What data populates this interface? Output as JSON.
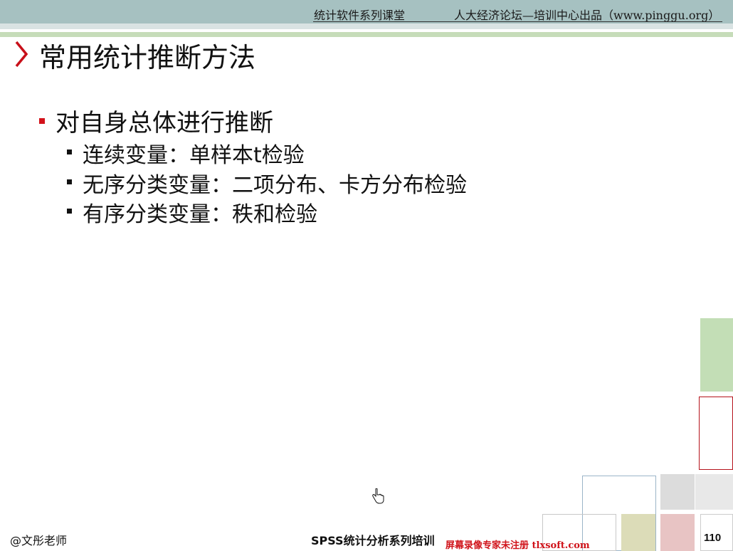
{
  "header": {
    "course": "统计软件系列课堂",
    "producer": "人大经济论坛—培训中心出品（www.pinggu.org）"
  },
  "slide": {
    "title": "常用统计推断方法",
    "bullets": [
      {
        "text": "对自身总体进行推断",
        "children": [
          "连续变量：单样本t检验",
          "无序分类变量：二项分布、卡方分布检验",
          "有序分类变量：秩和检验"
        ]
      }
    ]
  },
  "footer": {
    "author": "@文彤老师",
    "series": "SPSS统计分析系列培训",
    "page_number": "110",
    "watermark": "屏幕录像专家未注册 tlxsoft.com"
  },
  "colors": {
    "header_bg": "#a6c1c1",
    "accent_red": "#d3121a",
    "green_block": "#c3deb6"
  },
  "icons": {
    "title_marker": "chevron-right-icon",
    "cursor": "hand-pointer-icon"
  }
}
